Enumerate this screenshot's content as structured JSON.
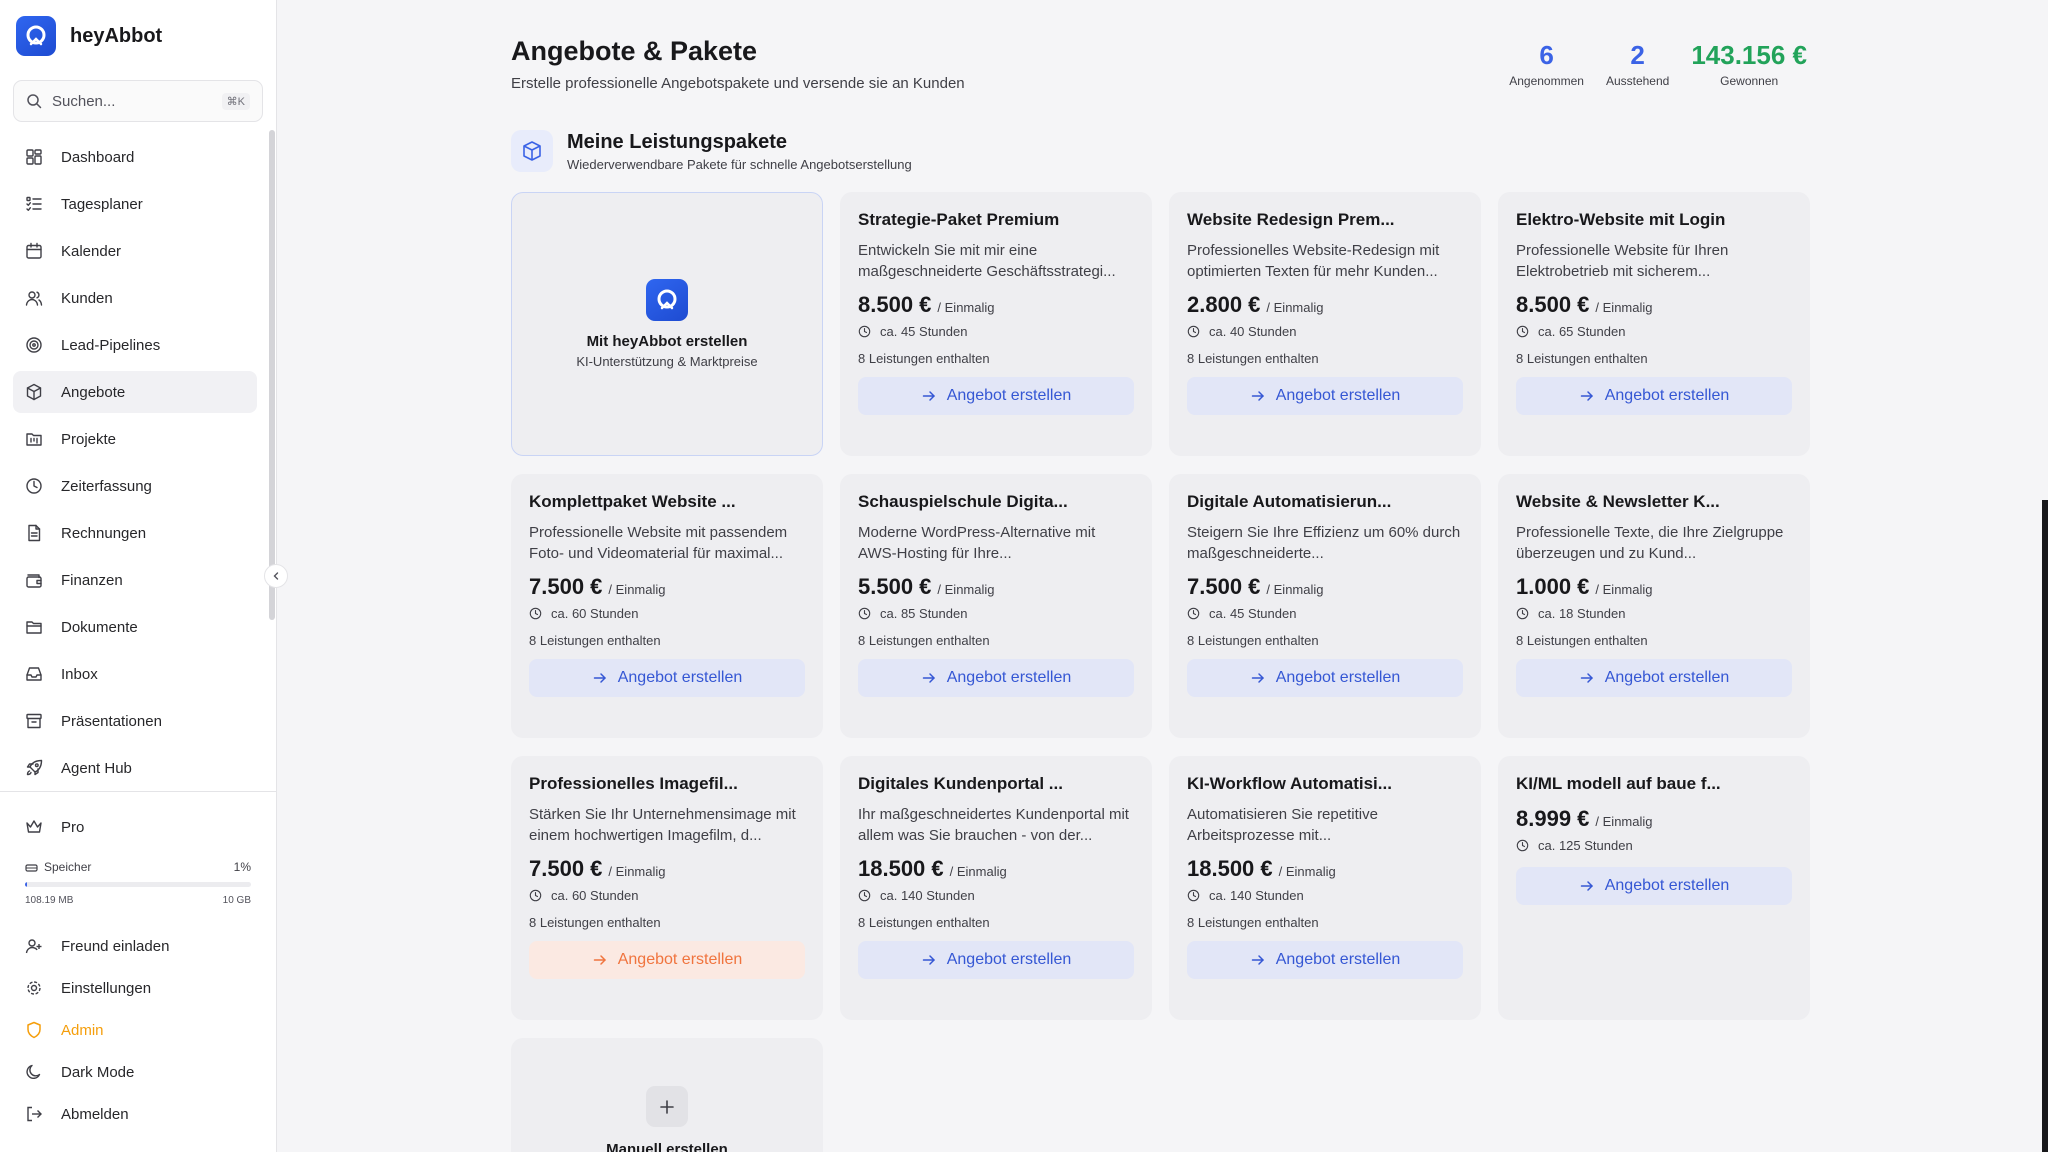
{
  "brand": {
    "name": "heyAbbot"
  },
  "search": {
    "placeholder": "Suchen...",
    "shortcut": "⌘K"
  },
  "nav": [
    {
      "label": "Dashboard",
      "icon": "grid-icon"
    },
    {
      "label": "Tagesplaner",
      "icon": "list-icon"
    },
    {
      "label": "Kalender",
      "icon": "calendar-icon"
    },
    {
      "label": "Kunden",
      "icon": "users-icon"
    },
    {
      "label": "Lead-Pipelines",
      "icon": "target-icon"
    },
    {
      "label": "Angebote",
      "icon": "package-icon",
      "active": true
    },
    {
      "label": "Projekte",
      "icon": "folder-kanban-icon"
    },
    {
      "label": "Zeiterfassung",
      "icon": "clock-icon"
    },
    {
      "label": "Rechnungen",
      "icon": "file-text-icon"
    },
    {
      "label": "Finanzen",
      "icon": "wallet-icon"
    },
    {
      "label": "Dokumente",
      "icon": "folder-icon"
    },
    {
      "label": "Inbox",
      "icon": "inbox-icon"
    },
    {
      "label": "Präsentationen",
      "icon": "presentation-icon"
    },
    {
      "label": "Agent Hub",
      "icon": "rocket-icon"
    }
  ],
  "plan": {
    "label": "Pro"
  },
  "storage": {
    "label": "Speicher",
    "percent_label": "1%",
    "used_fraction": 0.0103,
    "used": "108.19 MB",
    "total": "10 GB"
  },
  "bottom_nav": {
    "invite": "Freund einladen",
    "settings": "Einstellungen",
    "admin": "Admin",
    "dark_mode": "Dark Mode",
    "logout": "Abmelden"
  },
  "page": {
    "title": "Angebote & Pakete",
    "subtitle": "Erstelle professionelle Angebotspakete und versende sie an Kunden"
  },
  "stats": [
    {
      "value": "6",
      "label": "Angenommen",
      "color": "#3b63e6"
    },
    {
      "value": "2",
      "label": "Ausstehend",
      "color": "#3b63e6"
    },
    {
      "value": "143.156 €",
      "label": "Gewonnen",
      "color": "#22a35a"
    }
  ],
  "section": {
    "title": "Meine Leistungspakete",
    "subtitle": "Wiederverwendbare Pakete für schnelle Angebotserstellung"
  },
  "ai_card": {
    "title": "Mit heyAbbot erstellen",
    "subtitle": "KI-Unterstützung & Marktpreise"
  },
  "cta_label": "Angebot erstellen",
  "manual_card": {
    "title": "Manuell erstellen"
  },
  "packages": [
    {
      "title": "Strategie-Paket Premium",
      "desc": "Entwickeln Sie mit mir eine maßgeschneiderte Geschäftsstrategi...",
      "price": "8.500 €",
      "unit": "/ Einmalig",
      "hours": "ca. 45 Stunden",
      "services": "8 Leistungen enthalten"
    },
    {
      "title": "Website Redesign Prem...",
      "desc": "Professionelles Website-Redesign mit optimierten Texten für mehr Kunden...",
      "price": "2.800 €",
      "unit": "/ Einmalig",
      "hours": "ca. 40 Stunden",
      "services": "8 Leistungen enthalten"
    },
    {
      "title": "Elektro-Website mit Login",
      "desc": "Professionelle Website für Ihren Elektrobetrieb mit sicherem...",
      "price": "8.500 €",
      "unit": "/ Einmalig",
      "hours": "ca. 65 Stunden",
      "services": "8 Leistungen enthalten"
    },
    {
      "title": "Komplettpaket Website ...",
      "desc": "Professionelle Website mit passendem Foto- und Videomaterial für maximal...",
      "price": "7.500 €",
      "unit": "/ Einmalig",
      "hours": "ca. 60 Stunden",
      "services": "8 Leistungen enthalten"
    },
    {
      "title": "Schauspielschule Digita...",
      "desc": "Moderne WordPress-Alternative mit AWS-Hosting für Ihre...",
      "price": "5.500 €",
      "unit": "/ Einmalig",
      "hours": "ca. 85 Stunden",
      "services": "8 Leistungen enthalten"
    },
    {
      "title": "Digitale Automatisierun...",
      "desc": "Steigern Sie Ihre Effizienz um 60% durch maßgeschneiderte...",
      "price": "7.500 €",
      "unit": "/ Einmalig",
      "hours": "ca. 45 Stunden",
      "services": "8 Leistungen enthalten"
    },
    {
      "title": "Website & Newsletter K...",
      "desc": "Professionelle Texte, die Ihre Zielgruppe überzeugen und zu Kund...",
      "price": "1.000 €",
      "unit": "/ Einmalig",
      "hours": "ca. 18 Stunden",
      "services": "8 Leistungen enthalten"
    },
    {
      "title": "Professionelles Imagefil...",
      "desc": "Stärken Sie Ihr Unternehmensimage mit einem hochwertigen Imagefilm, d...",
      "price": "7.500 €",
      "unit": "/ Einmalig",
      "hours": "ca. 60 Stunden",
      "services": "8 Leistungen enthalten",
      "warm": true
    },
    {
      "title": "Digitales Kundenportal ...",
      "desc": "Ihr maßgeschneidertes Kundenportal mit allem was Sie brauchen - von der...",
      "price": "18.500 €",
      "unit": "/ Einmalig",
      "hours": "ca. 140 Stunden",
      "services": "8 Leistungen enthalten"
    },
    {
      "title": "KI-Workflow Automatisi...",
      "desc": "Automatisieren Sie repetitive Arbeitsprozesse mit...",
      "price": "18.500 €",
      "unit": "/ Einmalig",
      "hours": "ca. 140 Stunden",
      "services": "8 Leistungen enthalten"
    },
    {
      "title": "KI/ML modell auf baue f...",
      "desc": "",
      "price": "8.999 €",
      "unit": "/ Einmalig",
      "hours": "ca. 125 Stunden",
      "services": ""
    }
  ]
}
